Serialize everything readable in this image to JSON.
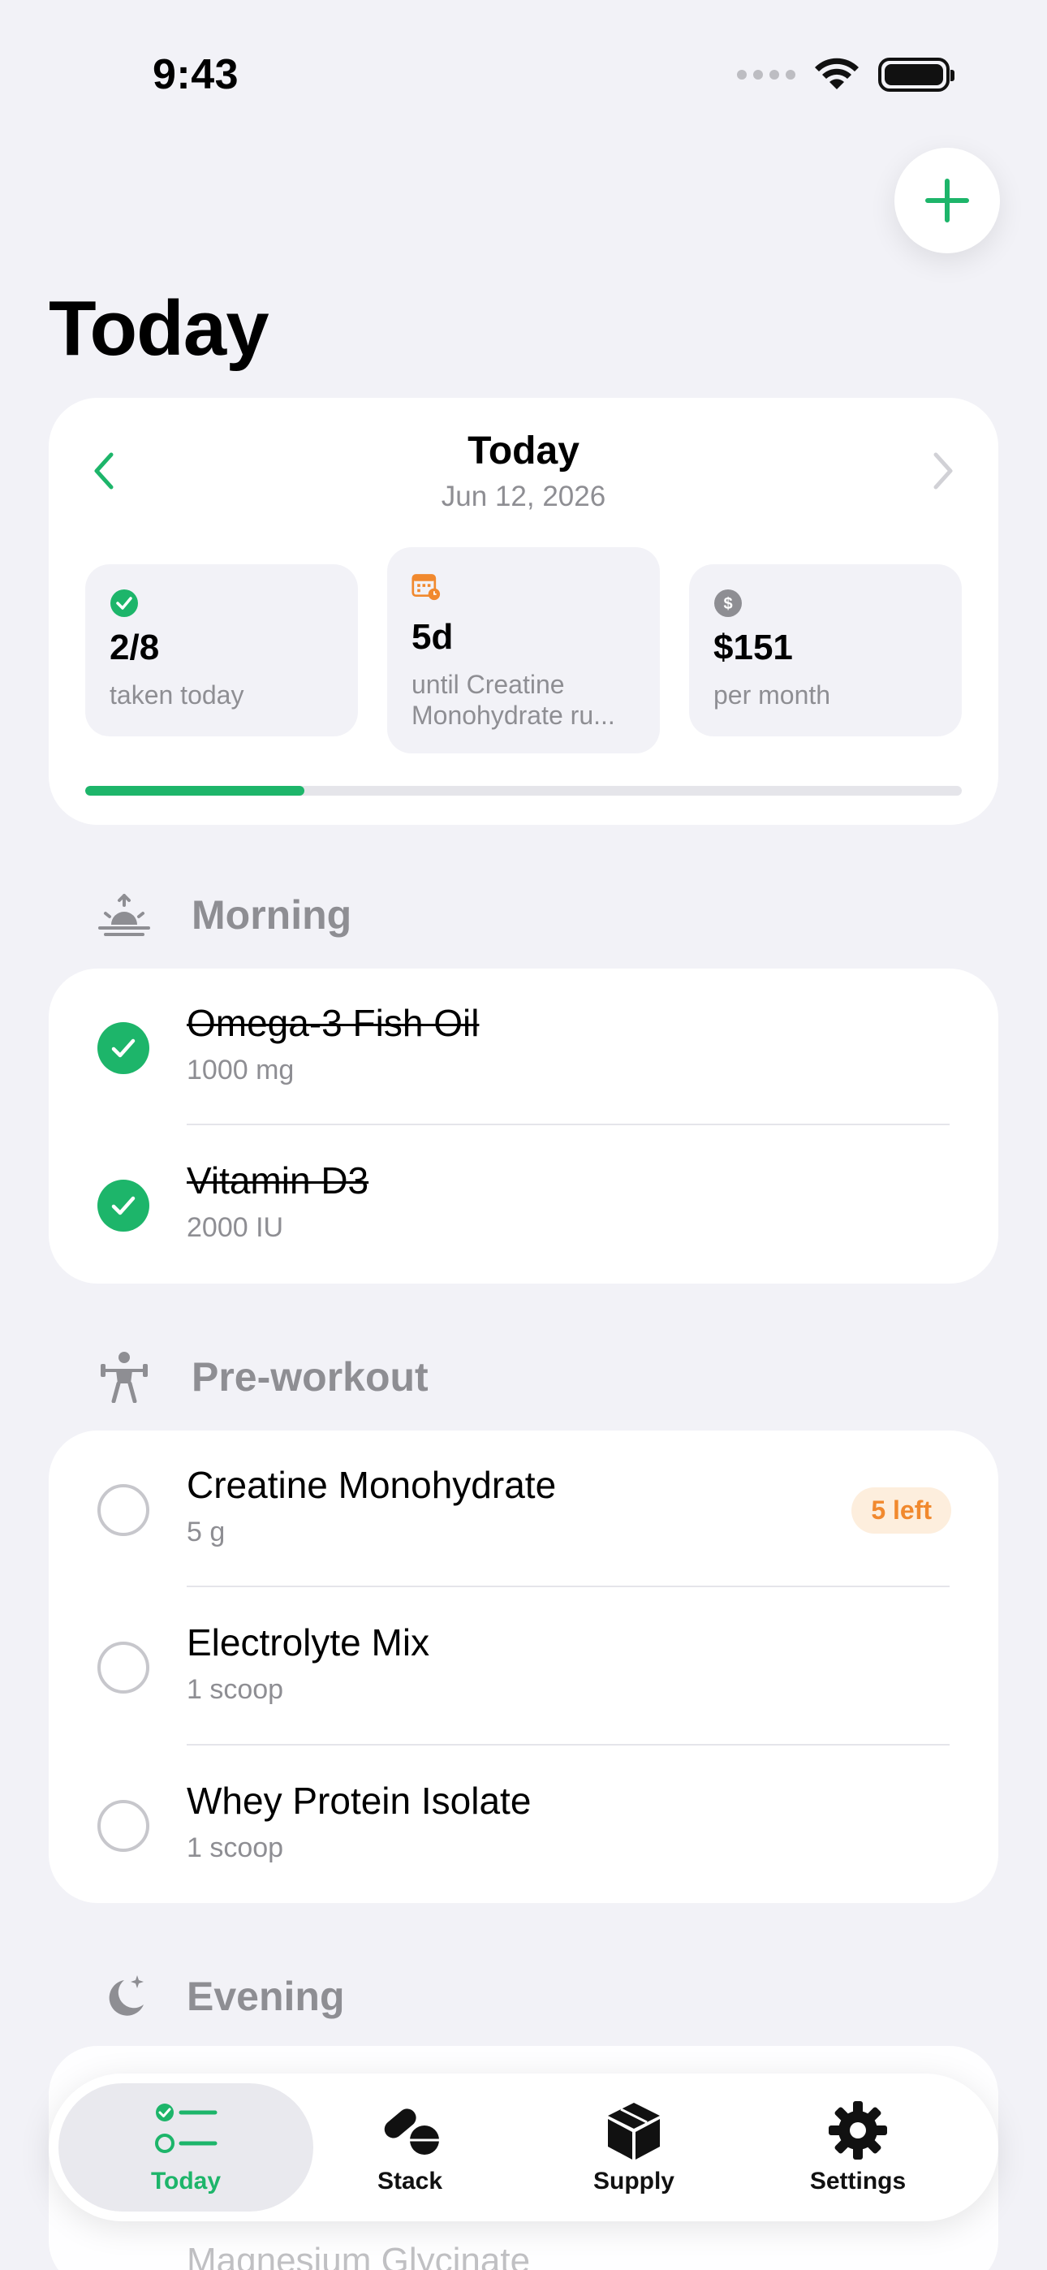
{
  "status_bar": {
    "time": "9:43"
  },
  "header": {
    "title": "Today"
  },
  "summary": {
    "date_title": "Today",
    "date_sub": "Jun 12, 2026",
    "stats": [
      {
        "icon": "check-circle-icon",
        "value": "2/8",
        "label": "taken today"
      },
      {
        "icon": "calendar-clock-icon",
        "value": "5d",
        "label_line1": "until Creatine",
        "label_line2": "Monohydrate ru..."
      },
      {
        "icon": "dollar-circle-icon",
        "value": "$151",
        "label": "per month"
      }
    ],
    "progress": 0.25
  },
  "sections": {
    "morning": {
      "label": "Morning",
      "icon": "sunrise-icon",
      "items": [
        {
          "name": "Omega-3 Fish Oil",
          "dose": "1000 mg",
          "taken": true
        },
        {
          "name": "Vitamin D3",
          "dose": "2000 IU",
          "taken": true
        }
      ]
    },
    "preworkout": {
      "label": "Pre-workout",
      "icon": "weightlifter-icon",
      "items": [
        {
          "name": "Creatine Monohydrate",
          "dose": "5 g",
          "taken": false,
          "badge": "5 left"
        },
        {
          "name": "Electrolyte Mix",
          "dose": "1 scoop",
          "taken": false
        },
        {
          "name": "Whey Protein Isolate",
          "dose": "1 scoop",
          "taken": false
        }
      ]
    },
    "evening": {
      "label": "Evening",
      "icon": "moon-stars-icon",
      "peek_item": "Magnesium Glycinate"
    }
  },
  "tabbar": {
    "tabs": [
      {
        "label": "Today",
        "icon": "checklist-icon",
        "active": true
      },
      {
        "label": "Stack",
        "icon": "pills-icon",
        "active": false
      },
      {
        "label": "Supply",
        "icon": "box-icon",
        "active": false
      },
      {
        "label": "Settings",
        "icon": "gear-icon",
        "active": false
      }
    ]
  },
  "colors": {
    "accent": "#1DB56A",
    "warning": "#F1892E",
    "background": "#F2F2F7"
  }
}
